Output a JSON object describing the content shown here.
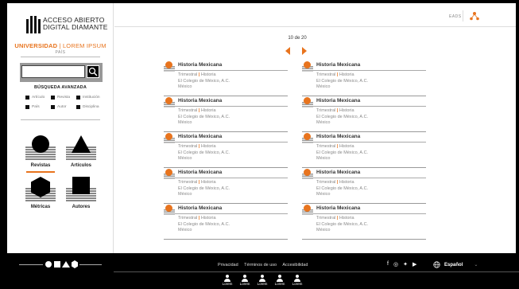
{
  "brand": {
    "line1": "ACCESO ABIERTO",
    "line2": "DIGITAL DIAMANTE",
    "univ_bold": "UNIVERSIDAD",
    "univ_sep": " | ",
    "univ_thin": "LOREM IPSUM",
    "country": "PAÍS"
  },
  "search": {
    "placeholder": "",
    "advanced_label": "BÚSQUEDA AVANZADA"
  },
  "filters": [
    [
      "Artículo",
      "Revista",
      "Institución"
    ],
    [
      "País",
      "Autor",
      "Disciplina"
    ]
  ],
  "nav": {
    "revistas": "Revistas",
    "articulos": "Artículos",
    "metricas": "Métricas",
    "autores": "Autores"
  },
  "topbar": {
    "lang": "EADS"
  },
  "pager": {
    "text": "10 de 20"
  },
  "cards": [
    {
      "title": "Historia Mexicana",
      "freq": "Trimestral",
      "sep": " | ",
      "disc": "Historia",
      "inst": "El Colegio de México, A.C.",
      "country": "México"
    },
    {
      "title": "Historia Mexicana",
      "freq": "Trimestral",
      "sep": " | ",
      "disc": "Historia",
      "inst": "El Colegio de México, A.C.",
      "country": "México"
    },
    {
      "title": "Historia Mexicana",
      "freq": "Trimestral",
      "sep": " | ",
      "disc": "Historia",
      "inst": "El Colegio de México, A.C.",
      "country": "México"
    },
    {
      "title": "Historia Mexicana",
      "freq": "Trimestral",
      "sep": " | ",
      "disc": "Historia",
      "inst": "El Colegio de México, A.C.",
      "country": "México"
    },
    {
      "title": "Historia Mexicana",
      "freq": "Trimestral",
      "sep": " | ",
      "disc": "Historia",
      "inst": "El Colegio de México, A.C.",
      "country": "México"
    },
    {
      "title": "Historia Mexicana",
      "freq": "Trimestral",
      "sep": " | ",
      "disc": "Historia",
      "inst": "El Colegio de México, A.C.",
      "country": "México"
    },
    {
      "title": "Historia Mexicana",
      "freq": "Trimestral",
      "sep": " | ",
      "disc": "Historia",
      "inst": "El Colegio de México, A.C.",
      "country": "México"
    },
    {
      "title": "Historia Mexicana",
      "freq": "Trimestral",
      "sep": " | ",
      "disc": "Historia",
      "inst": "El Colegio de México, A.C.",
      "country": "México"
    },
    {
      "title": "Historia Mexicana",
      "freq": "Trimestral",
      "sep": " | ",
      "disc": "Historia",
      "inst": "El Colegio de México, A.C.",
      "country": "México"
    },
    {
      "title": "Historia Mexicana",
      "freq": "Trimestral",
      "sep": " | ",
      "disc": "Historia",
      "inst": "El Colegio de México, A.C.",
      "country": "México"
    }
  ],
  "footer": {
    "links": [
      "Privacidad",
      "Términos de uso",
      "Accesibilidad"
    ],
    "social_icons": [
      "facebook-icon",
      "instagram-icon",
      "twitter-icon",
      "youtube-icon"
    ],
    "language": "Español",
    "people": [
      "Lorem",
      "Lorem",
      "Lorem",
      "Lorem",
      "Lorem"
    ]
  },
  "colors": {
    "accent": "#e8741e",
    "dark": "#111111",
    "background": "#000000"
  }
}
